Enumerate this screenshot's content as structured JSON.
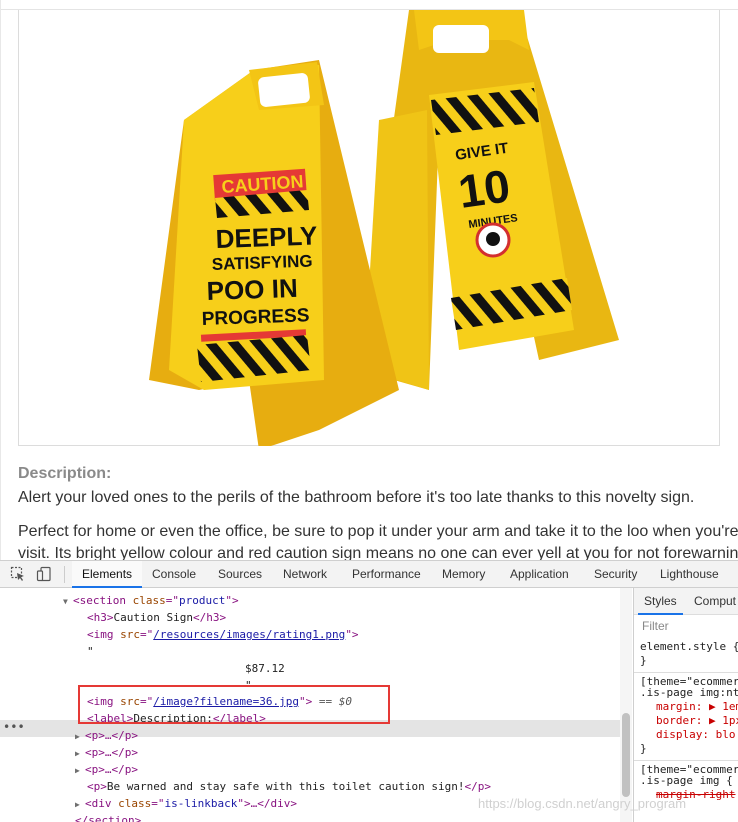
{
  "page": {
    "description_heading": "Description:",
    "description_p1": "Alert your loved ones to the perils of the bathroom before it's too late thanks to this novelty sign.",
    "description_p2": "Perfect for home or even the office, be sure to pop it under your arm and take it to the loo when you're visit. Its bright yellow colour and red caution sign means no one can ever yell at you for not forewarnin",
    "product_image": {
      "front_sign": {
        "caution": "CAUTION",
        "line1": "DEEPLY",
        "line2": "SATISFYING",
        "line3": "POO IN",
        "line4": "PROGRESS"
      },
      "back_sign": {
        "line1": "GIVE IT",
        "line2": "10",
        "line3": "MINUTES"
      },
      "colors": {
        "sign_yellow": "#f7cf1a",
        "sign_shadow": "#e0a80c",
        "caution_red": "#e53935"
      }
    }
  },
  "devtools": {
    "tabs": [
      "Elements",
      "Console",
      "Sources",
      "Network",
      "Performance",
      "Memory",
      "Application",
      "Security",
      "Lighthouse"
    ],
    "active_tab": "Elements",
    "dom": {
      "section_open": {
        "tag": "section",
        "attr": "class",
        "val": "product"
      },
      "h3": {
        "open": "<h3>",
        "text": "Caution Sign",
        "close": "</h3>"
      },
      "img_rating": {
        "attr": "src",
        "val": "/resources/images/rating1.png"
      },
      "quote1": "\"",
      "price": "$87.12",
      "quote2": "\"",
      "img_product": {
        "attr": "src",
        "val": "/image?filename=36.jpg",
        "suffix": "== $0"
      },
      "label": {
        "text": "Description:"
      },
      "p_collapsed": "<p>…</p>",
      "p_warn": "Be warned and stay safe with this toilet caution sign!",
      "div_linkback": {
        "attr": "class",
        "val": "is-linkback"
      },
      "section_close": "</section>"
    },
    "styles_pane": {
      "tabs": [
        "Styles",
        "Comput"
      ],
      "filter_placeholder": "Filter",
      "element_style": "element.style {",
      "close_brace": "}",
      "rule1_selector_a": "[theme=\"ecommer",
      "rule1_selector_b": ".is-page img:nt",
      "rule1_props": [
        "margin: ▶ 1em",
        "border: ▶ 1px",
        "display: blo"
      ],
      "rule2_selector_a": "[theme=\"ecommer",
      "rule2_selector_b": ".is-page img {",
      "rule2_prop": "margin-right"
    },
    "watermark": "https://blog.csdn.net/angry_program"
  }
}
